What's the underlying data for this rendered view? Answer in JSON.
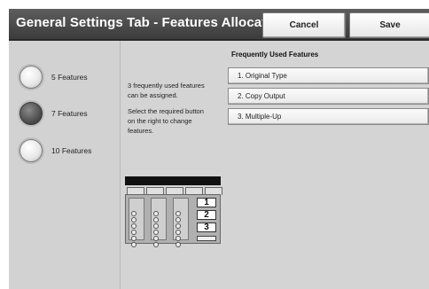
{
  "header": {
    "title": "General Settings Tab - Features Allocation",
    "cancel_label": "Cancel",
    "save_label": "Save"
  },
  "options": [
    {
      "label": "5 Features",
      "selected": false
    },
    {
      "label": "7 Features",
      "selected": true
    },
    {
      "label": "10 Features",
      "selected": false
    }
  ],
  "info": {
    "line1": "3 frequently used features",
    "line2": "can be assigned.",
    "line3": "Select the required button",
    "line4": "on the right to change",
    "line5": "features."
  },
  "illustration": {
    "numbers": [
      "1",
      "2",
      "3"
    ]
  },
  "frequent": {
    "title": "Frequently Used Features",
    "items": [
      "1.  Original Type",
      "2.  Copy Output",
      "3.  Multiple-Up"
    ]
  }
}
